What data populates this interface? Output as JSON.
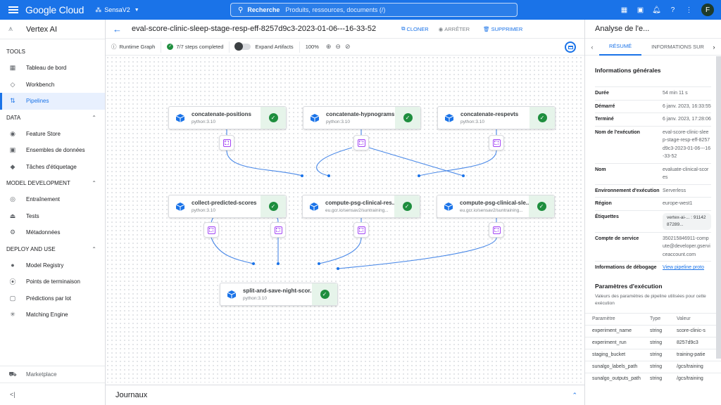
{
  "topbar": {
    "brand": "Google Cloud",
    "project": "SensaV2",
    "search_label": "Recherche",
    "search_placeholder": "Produits, ressources, documents (/)",
    "icons": [
      "gift-icon",
      "terminal-icon",
      "bell-icon",
      "help-icon",
      "more-vert-icon"
    ],
    "avatar_initial": "F"
  },
  "sidebar": {
    "title": "Vertex AI",
    "sections": [
      {
        "label": "TOOLS",
        "collapsible": false,
        "items": [
          {
            "label": "Tableau de bord",
            "icon": "dashboard-icon",
            "glyph": "▦"
          },
          {
            "label": "Workbench",
            "icon": "workbench-icon",
            "glyph": "◇"
          },
          {
            "label": "Pipelines",
            "icon": "pipelines-icon",
            "glyph": "⇅",
            "active": true
          }
        ]
      },
      {
        "label": "DATA",
        "collapsible": true,
        "items": [
          {
            "label": "Feature Store",
            "icon": "feature-store-icon",
            "glyph": "◉"
          },
          {
            "label": "Ensembles de données",
            "icon": "datasets-icon",
            "glyph": "▣"
          },
          {
            "label": "Tâches d'étiquetage",
            "icon": "label-icon",
            "glyph": "◆"
          }
        ]
      },
      {
        "label": "MODEL DEVELOPMENT",
        "collapsible": true,
        "items": [
          {
            "label": "Entraînement",
            "icon": "training-icon",
            "glyph": "◎"
          },
          {
            "label": "Tests",
            "icon": "experiments-icon",
            "glyph": "⏏"
          },
          {
            "label": "Métadonnées",
            "icon": "metadata-icon",
            "glyph": "⚙"
          }
        ]
      },
      {
        "label": "DEPLOY AND USE",
        "collapsible": true,
        "items": [
          {
            "label": "Model Registry",
            "icon": "model-registry-icon",
            "glyph": "●"
          },
          {
            "label": "Points de terminaison",
            "icon": "endpoints-icon",
            "glyph": "⦿"
          },
          {
            "label": "Prédictions par lot",
            "icon": "batch-predictions-icon",
            "glyph": "▢"
          },
          {
            "label": "Matching Engine",
            "icon": "matching-engine-icon",
            "glyph": "✳"
          }
        ]
      }
    ],
    "marketplace": "Marketplace",
    "collapse_label": "<|"
  },
  "header": {
    "title": "eval-score-clinic-sleep-stage-resp-eff-8257d9c3-2023-01-06---16-33-52",
    "actions": {
      "clone": "CLONER",
      "stop": "ARRÊTER",
      "delete": "SUPPRIMER"
    }
  },
  "toolbar": {
    "runtime_graph": "Runtime Graph",
    "steps": "7/7 steps completed",
    "expand_artifacts": "Expand Artifacts",
    "expand_artifacts_on": false,
    "zoom": "100%"
  },
  "graph": {
    "nodes": [
      {
        "id": "n1",
        "name": "concatenate-positions",
        "sub": "python:3.10",
        "status": "succeeded"
      },
      {
        "id": "n2",
        "name": "concatenate-hypnograms",
        "sub": "python:3.10",
        "status": "succeeded"
      },
      {
        "id": "n3",
        "name": "concatenate-respevts",
        "sub": "python:3.10",
        "status": "succeeded"
      },
      {
        "id": "n4",
        "name": "collect-predicted-scores",
        "sub": "python:3.10",
        "status": "succeeded"
      },
      {
        "id": "n5",
        "name": "compute-psg-clinical-res...",
        "sub": "eu.gcr.io/sensav2/suntraining...",
        "status": "succeeded"
      },
      {
        "id": "n6",
        "name": "compute-psg-clinical-sle...",
        "sub": "eu.gcr.io/sensav2/suntraining...",
        "status": "succeeded"
      },
      {
        "id": "n7",
        "name": "split-and-save-night-scor...",
        "sub": "python:3.10",
        "status": "succeeded"
      }
    ],
    "artifact_count": 7
  },
  "logs": {
    "title": "Journaux"
  },
  "details": {
    "title": "Analyse de l'e...",
    "tabs": [
      "RÉSUMÉ",
      "INFORMATIONS SUR"
    ],
    "active_tab": 0,
    "general_heading": "Informations générales",
    "fields": [
      {
        "key": "Durée",
        "value": "54 min 11 s"
      },
      {
        "key": "Démarré",
        "value": "6 janv. 2023, 16:33:55"
      },
      {
        "key": "Terminé",
        "value": "6 janv. 2023, 17:28:06"
      },
      {
        "key": "Nom de l'exécution",
        "value": "eval-score-clinic-sleep-stage-resp-eff-8257d9c3-2023-01-06---16-33-52"
      },
      {
        "key": "Nom",
        "value": "evaluate-clinical-scores"
      },
      {
        "key": "Environnement d'exécution",
        "value": "Serverless"
      },
      {
        "key": "Région",
        "value": "europe-west1"
      },
      {
        "key": "Étiquettes",
        "chip": "vertex-ai-... : 9114287289..."
      },
      {
        "key": "Compte de service",
        "value": "350215846911-compute@developer.gserviceaccount.com"
      },
      {
        "key": "Informations de débogage",
        "link": "View pipeline proto"
      }
    ],
    "params_heading": "Paramètres d'exécution",
    "params_desc": "Valeurs des paramètres de pipeline utilisées pour cette exécution",
    "params_columns": [
      "Paramètre",
      "Type",
      "Valeur"
    ],
    "params": [
      [
        "experiment_name",
        "string",
        "score-clinic-s"
      ],
      [
        "experiment_run",
        "string",
        "8257d9c3"
      ],
      [
        "staging_bucket",
        "string",
        "training-patie"
      ],
      [
        "sunalgo_labels_path",
        "string",
        "/gcs/training"
      ],
      [
        "sunalgo_outputs_path",
        "string",
        "/gcs/training"
      ]
    ]
  }
}
